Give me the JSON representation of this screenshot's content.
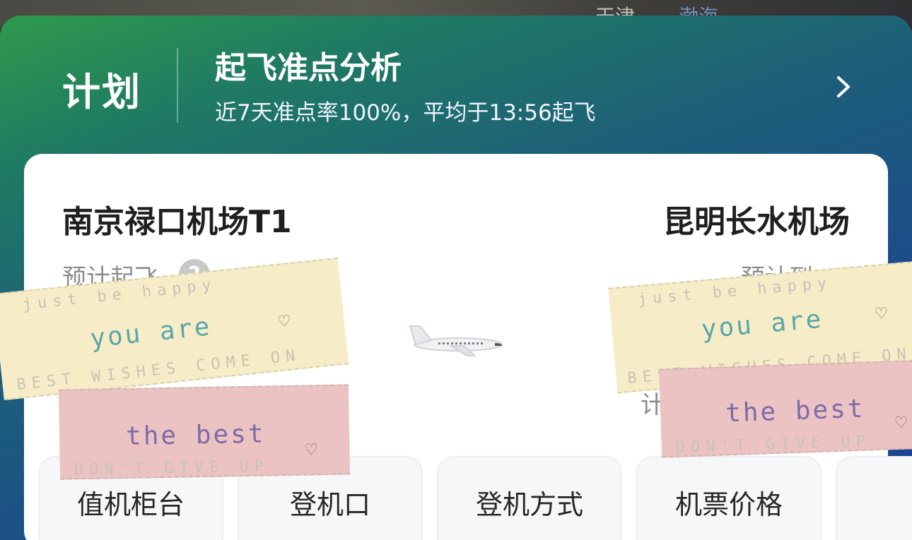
{
  "map": {
    "labels": [
      "天津",
      "渤海"
    ]
  },
  "header": {
    "plan_label": "计划",
    "title": "起飞准点分析",
    "subtitle": "近7天准点率100%，平均于13:56起飞",
    "chevron_icon": "chevron-right-icon"
  },
  "flight": {
    "departure_airport": "南京禄口机场T1",
    "arrival_airport": "昆明长水机场",
    "departure_label": "预计起飞",
    "arrival_label": "预计到",
    "arrival_label_2": "计",
    "help_icon": "question-circle-icon",
    "plane_icon": "airplane-icon"
  },
  "tabs": [
    {
      "label": "值机柜台"
    },
    {
      "label": "登机口"
    },
    {
      "label": "登机方式"
    },
    {
      "label": "机票价格"
    },
    {
      "label": ""
    }
  ],
  "stickers": {
    "top_line": "just be happy",
    "main_line_1": "you  are",
    "bottom_line_yellow": "BEST WISHES COME ON",
    "main_line_2": "the  best",
    "bottom_line_pink": "DON'T GIVE UP",
    "heart": "♡"
  },
  "colors": {
    "panel_gradient_start": "#2f9a4c",
    "panel_gradient_end": "#1b3f96",
    "card": "#ffffff",
    "tab_bg": "#f6f7f9",
    "tape_yellow": "#f6edc8",
    "tape_pink": "#ecc3c3"
  }
}
